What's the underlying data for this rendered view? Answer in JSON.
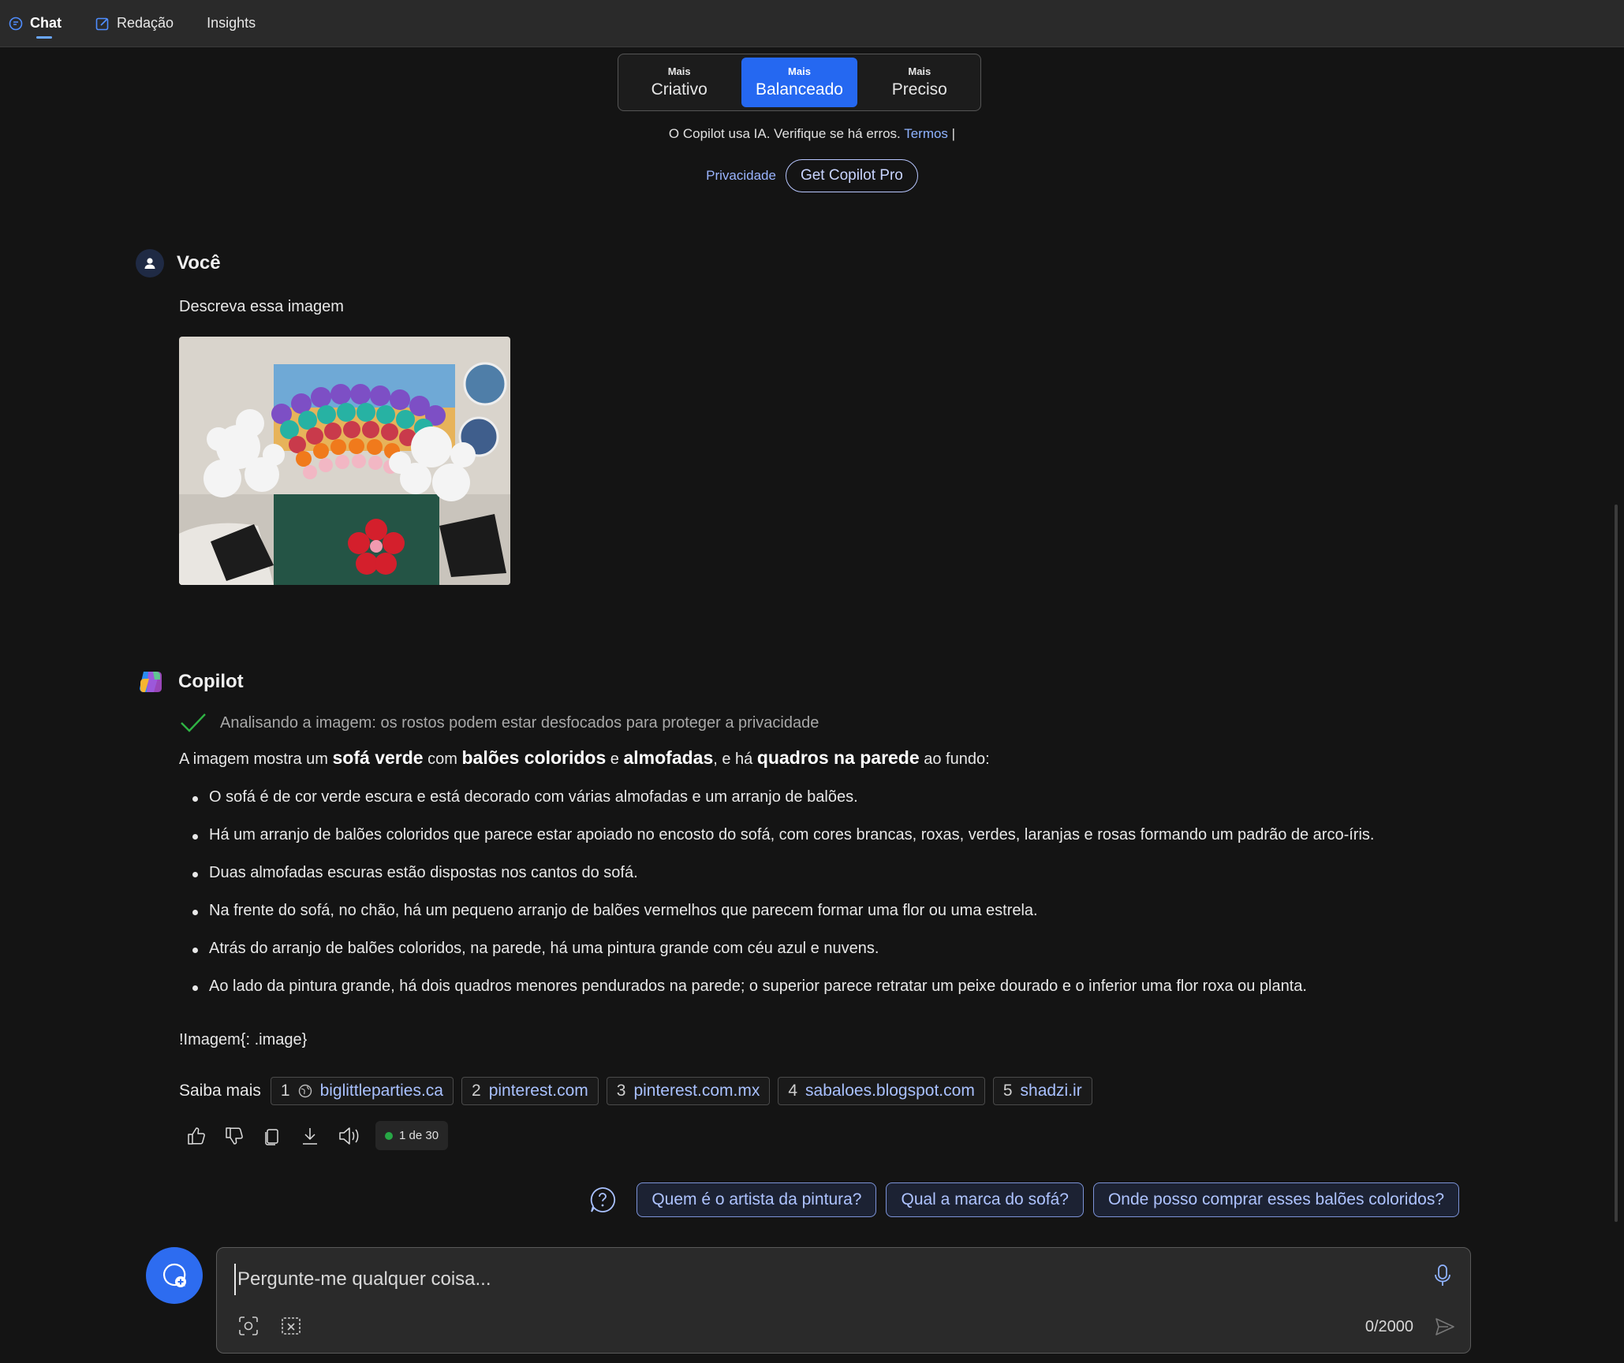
{
  "nav": {
    "tabs": [
      {
        "label": "Chat",
        "icon": "chat-icon",
        "active": true
      },
      {
        "label": "Redação",
        "icon": "compose-icon",
        "active": false
      },
      {
        "label": "Insights",
        "active": false
      }
    ]
  },
  "tone": {
    "options": [
      {
        "small": "Mais",
        "big": "Criativo",
        "active": false
      },
      {
        "small": "Mais",
        "big": "Balanceado",
        "active": true
      },
      {
        "small": "Mais",
        "big": "Preciso",
        "active": false
      }
    ]
  },
  "disclaimer": {
    "text": "O Copilot usa IA. Verifique se há erros.",
    "terms": "Termos",
    "separator": "|",
    "privacy": "Privacidade",
    "pro_button": "Get Copilot Pro"
  },
  "user_message": {
    "author": "Você",
    "text": "Descreva essa imagem",
    "image_icon": "sofa-balloons-photo"
  },
  "copilot_message": {
    "author": "Copilot",
    "status": "Analisando a imagem: os rostos podem estar desfocados para proteger a privacidade",
    "intro": {
      "p1": "A imagem mostra um ",
      "b1": "sofá verde",
      "p2": " com ",
      "b2": "balões coloridos",
      "p3": " e ",
      "b3": "almofadas",
      "p4": ", e há ",
      "b4": "quadros na parede",
      "p5": " ao fundo:"
    },
    "bullets": [
      "O sofá é de cor verde escura e está decorado com várias almofadas e um arranjo de balões.",
      "Há um arranjo de balões coloridos que parece estar apoiado no encosto do sofá, com cores brancas, roxas, verdes, laranjas e rosas formando um padrão de arco-íris.",
      "Duas almofadas escuras estão dispostas nos cantos do sofá.",
      "Na frente do sofá, no chão, há um pequeno arranjo de balões vermelhos que parecem formar uma flor ou uma estrela.",
      "Atrás do arranjo de balões coloridos, na parede, há uma pintura grande com céu azul e nuvens.",
      "Ao lado da pintura grande, há dois quadros menores pendurados na parede; o superior parece retratar um peixe dourado e o inferior uma flor roxa ou planta."
    ],
    "image_markup": "!Imagem{: .image}",
    "learn_more": "Saiba mais",
    "sources": [
      {
        "num": "1",
        "label": "biglittleparties.ca"
      },
      {
        "num": "2",
        "label": "pinterest.com"
      },
      {
        "num": "3",
        "label": "pinterest.com.mx"
      },
      {
        "num": "4",
        "label": "sabaloes.blogspot.com"
      },
      {
        "num": "5",
        "label": "shadzi.ir"
      }
    ],
    "response_counter": "1 de 30"
  },
  "suggestions": [
    "Quem é o artista da pintura?",
    "Qual a marca do sofá?",
    "Onde posso comprar esses balões coloridos?"
  ],
  "composer": {
    "placeholder": "Pergunte-me qualquer coisa...",
    "char_count": "0/2000"
  },
  "colors": {
    "accent": "#2568f1",
    "background": "#141414",
    "link": "#8fb3ff",
    "status_ok": "#27a745"
  }
}
